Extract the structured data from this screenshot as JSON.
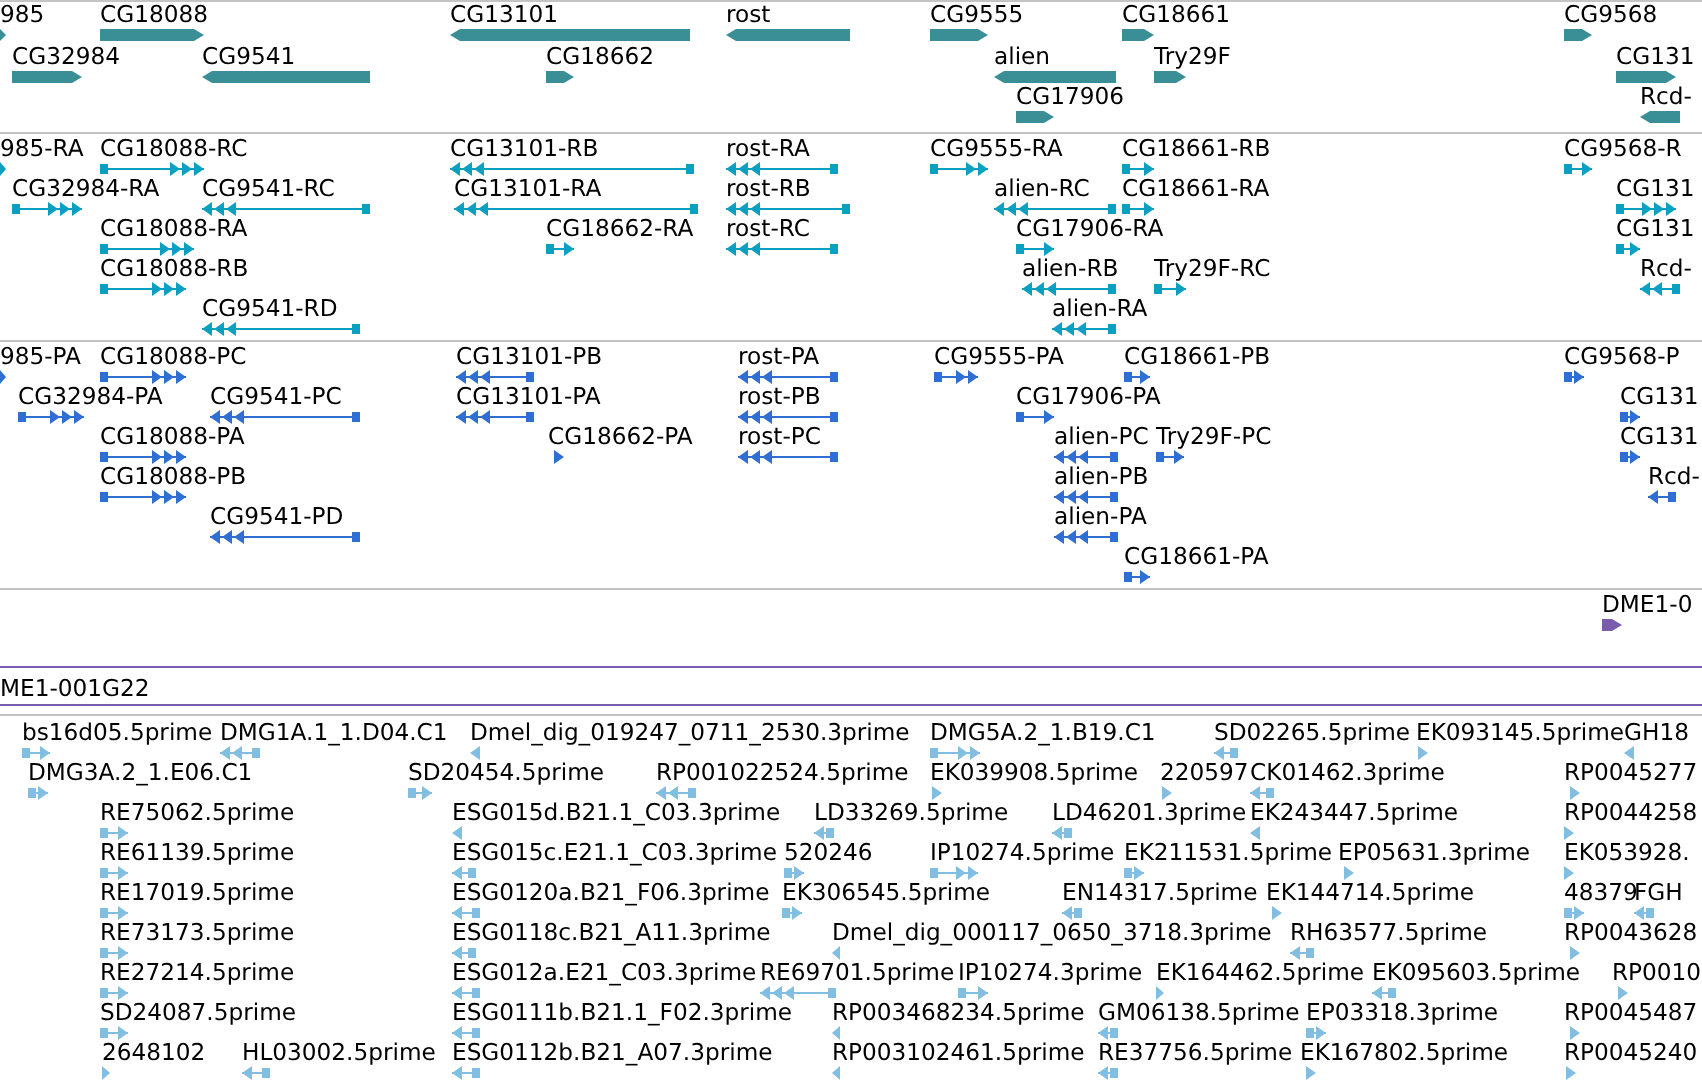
{
  "tracks": [
    {
      "kind": "gene",
      "features": [
        {
          "label": "985",
          "reverse": false
        },
        {
          "label": "CG18088",
          "reverse": false
        },
        {
          "label": "CG13101",
          "reverse": true
        },
        {
          "label": "rost",
          "reverse": true
        },
        {
          "label": "CG9555",
          "reverse": false
        },
        {
          "label": "CG18661",
          "reverse": false
        },
        {
          "label": "CG9568",
          "reverse": false
        },
        {
          "label": "CG32984",
          "reverse": false
        },
        {
          "label": "CG9541",
          "reverse": true
        },
        {
          "label": "CG18662",
          "reverse": false
        },
        {
          "label": "alien",
          "reverse": true
        },
        {
          "label": "Try29F",
          "reverse": false
        },
        {
          "label": "CG131",
          "reverse": false
        },
        {
          "label": "CG17906",
          "reverse": false
        },
        {
          "label": "Rcd-",
          "reverse": true
        }
      ]
    },
    {
      "kind": "transcript",
      "features": [
        {
          "label": "985-RA",
          "reverse": false
        },
        {
          "label": "CG18088-RC",
          "reverse": false
        },
        {
          "label": "CG13101-RB",
          "reverse": true
        },
        {
          "label": "rost-RA",
          "reverse": true
        },
        {
          "label": "CG9555-RA",
          "reverse": false
        },
        {
          "label": "CG18661-RB",
          "reverse": false
        },
        {
          "label": "CG9568-R",
          "reverse": false
        },
        {
          "label": "CG32984-RA",
          "reverse": false
        },
        {
          "label": "CG9541-RC",
          "reverse": true
        },
        {
          "label": "CG13101-RA",
          "reverse": true
        },
        {
          "label": "rost-RB",
          "reverse": true
        },
        {
          "label": "alien-RC",
          "reverse": true
        },
        {
          "label": "CG18661-RA",
          "reverse": false
        },
        {
          "label": "CG131",
          "reverse": false
        },
        {
          "label": "CG18088-RA",
          "reverse": false
        },
        {
          "label": "CG18662-RA",
          "reverse": false
        },
        {
          "label": "rost-RC",
          "reverse": true
        },
        {
          "label": "CG17906-RA",
          "reverse": false
        },
        {
          "label": "CG131",
          "reverse": false
        },
        {
          "label": "CG18088-RB",
          "reverse": false
        },
        {
          "label": "alien-RB",
          "reverse": true
        },
        {
          "label": "Try29F-RC",
          "reverse": false
        },
        {
          "label": "Rcd-",
          "reverse": true
        },
        {
          "label": "CG9541-RD",
          "reverse": true
        },
        {
          "label": "alien-RA",
          "reverse": true
        }
      ]
    },
    {
      "kind": "protein",
      "features": [
        {
          "label": "985-PA",
          "reverse": false
        },
        {
          "label": "CG18088-PC",
          "reverse": false
        },
        {
          "label": "CG13101-PB",
          "reverse": true
        },
        {
          "label": "rost-PA",
          "reverse": true
        },
        {
          "label": "CG9555-PA",
          "reverse": false
        },
        {
          "label": "CG18661-PB",
          "reverse": false
        },
        {
          "label": "CG9568-P",
          "reverse": false
        },
        {
          "label": "CG32984-PA",
          "reverse": false
        },
        {
          "label": "CG9541-PC",
          "reverse": true
        },
        {
          "label": "CG13101-PA",
          "reverse": true
        },
        {
          "label": "rost-PB",
          "reverse": true
        },
        {
          "label": "CG17906-PA",
          "reverse": false
        },
        {
          "label": "CG131",
          "reverse": false
        },
        {
          "label": "CG18088-PA",
          "reverse": false
        },
        {
          "label": "CG18662-PA",
          "reverse": false
        },
        {
          "label": "rost-PC",
          "reverse": true
        },
        {
          "label": "alien-PC",
          "reverse": true
        },
        {
          "label": "Try29F-PC",
          "reverse": false
        },
        {
          "label": "CG131",
          "reverse": false
        },
        {
          "label": "CG18088-PB",
          "reverse": false
        },
        {
          "label": "alien-PB",
          "reverse": true
        },
        {
          "label": "Rcd-",
          "reverse": true
        },
        {
          "label": "CG9541-PD",
          "reverse": true
        },
        {
          "label": "alien-PA",
          "reverse": true
        },
        {
          "label": "CG18661-PA",
          "reverse": false
        }
      ]
    },
    {
      "kind": "clone",
      "features": [
        {
          "label": "DME1-0",
          "reverse": false
        }
      ]
    }
  ],
  "region_label": "ME1-001G22",
  "est_track": {
    "kind": "est",
    "features": [
      {
        "label": "bs16d05.5prime",
        "reverse": false
      },
      {
        "label": "DMG1A.1_1.D04.C1",
        "reverse": true
      },
      {
        "label": "Dmel_dig_019247_0711_2530.3prime",
        "reverse": true
      },
      {
        "label": "DMG5A.2_1.B19.C1",
        "reverse": false
      },
      {
        "label": "SD02265.5prime",
        "reverse": true
      },
      {
        "label": "EK093145.5prime",
        "reverse": false
      },
      {
        "label": "GH18",
        "reverse": true
      },
      {
        "label": "DMG3A.2_1.E06.C1",
        "reverse": false
      },
      {
        "label": "SD20454.5prime",
        "reverse": false
      },
      {
        "label": "RP001022524.5prime",
        "reverse": true
      },
      {
        "label": "EK039908.5prime",
        "reverse": false
      },
      {
        "label": "220597",
        "reverse": false
      },
      {
        "label": "CK01462.3prime",
        "reverse": true
      },
      {
        "label": "RP0045277",
        "reverse": false
      },
      {
        "label": "RE75062.5prime",
        "reverse": false
      },
      {
        "label": "ESG015d.B21.1_C03.3prime",
        "reverse": true
      },
      {
        "label": "LD33269.5prime",
        "reverse": true
      },
      {
        "label": "LD46201.3prime",
        "reverse": true
      },
      {
        "label": "EK243447.5prime",
        "reverse": true
      },
      {
        "label": "RP0044258",
        "reverse": false
      },
      {
        "label": "RE61139.5prime",
        "reverse": false
      },
      {
        "label": "ESG015c.E21.1_C03.3prime",
        "reverse": true
      },
      {
        "label": "520246",
        "reverse": false
      },
      {
        "label": "IP10274.5prime",
        "reverse": false
      },
      {
        "label": "EK211531.5prime",
        "reverse": false
      },
      {
        "label": "EP05631.3prime",
        "reverse": false
      },
      {
        "label": "EK053928.",
        "reverse": false
      },
      {
        "label": "RE17019.5prime",
        "reverse": false
      },
      {
        "label": "ESG0120a.B21_F06.3prime",
        "reverse": true
      },
      {
        "label": "EK306545.5prime",
        "reverse": false
      },
      {
        "label": "EN14317.5prime",
        "reverse": true
      },
      {
        "label": "EK144714.5prime",
        "reverse": false
      },
      {
        "label": "48379",
        "reverse": false
      },
      {
        "label": "FGH",
        "reverse": true
      },
      {
        "label": "RE73173.5prime",
        "reverse": false
      },
      {
        "label": "ESG0118c.B21_A11.3prime",
        "reverse": true
      },
      {
        "label": "Dmel_dig_000117_0650_3718.3prime",
        "reverse": true
      },
      {
        "label": "RH63577.5prime",
        "reverse": true
      },
      {
        "label": "RP0043628",
        "reverse": false
      },
      {
        "label": "RE27214.5prime",
        "reverse": false
      },
      {
        "label": "ESG012a.E21_C03.3prime",
        "reverse": true
      },
      {
        "label": "RE69701.5prime",
        "reverse": true
      },
      {
        "label": "IP10274.3prime",
        "reverse": false
      },
      {
        "label": "EK164462.5prime",
        "reverse": false
      },
      {
        "label": "EK095603.5prime",
        "reverse": true
      },
      {
        "label": "RP0010",
        "reverse": false
      },
      {
        "label": "SD24087.5prime",
        "reverse": false
      },
      {
        "label": "ESG0111b.B21.1_F02.3prime",
        "reverse": true
      },
      {
        "label": "RP003468234.5prime",
        "reverse": true
      },
      {
        "label": "GM06138.5prime",
        "reverse": true
      },
      {
        "label": "EP03318.3prime",
        "reverse": false
      },
      {
        "label": "RP0045487",
        "reverse": false
      },
      {
        "label": "2648102",
        "reverse": false
      },
      {
        "label": "HL03002.5prime",
        "reverse": true
      },
      {
        "label": "ESG0112b.B21_A07.3prime",
        "reverse": true
      },
      {
        "label": "RP003102461.5prime",
        "reverse": true
      },
      {
        "label": "RE37756.5prime",
        "reverse": true
      },
      {
        "label": "EK167802.5prime",
        "reverse": false
      },
      {
        "label": "RP0045240",
        "reverse": false
      }
    ]
  }
}
